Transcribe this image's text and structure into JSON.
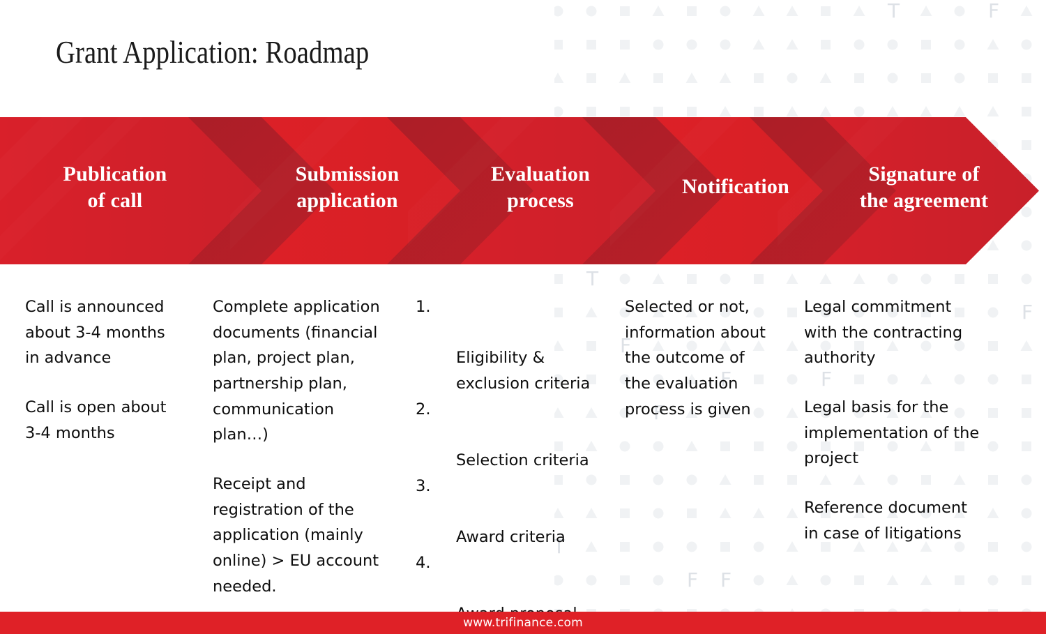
{
  "title": "Grant Application: Roadmap",
  "brand": {
    "red": "#DF2127",
    "red_dark": "#AE1F26",
    "red_mid": "#C5202A",
    "pattern_gray": "#F0F2F4",
    "text_dark": "#0d0d0d"
  },
  "roadmap": {
    "steps": [
      {
        "label": "Publication\nof call"
      },
      {
        "label": "Submission\napplication"
      },
      {
        "label": "Evaluation\nprocess"
      },
      {
        "label": "Notification"
      },
      {
        "label": "Signature of\nthe agreement"
      }
    ]
  },
  "columns": [
    {
      "key": "publication",
      "type": "paragraphs",
      "paragraphs": [
        "Call is announced\nabout 3-4 months\nin advance",
        "Call is open about\n3-4 months"
      ]
    },
    {
      "key": "submission",
      "type": "paragraphs",
      "paragraphs": [
        "Complete application\ndocuments (financial\nplan, project plan,\npartnership plan,\ncommunication\nplan…)",
        "Receipt and\nregistration of the\napplication (mainly\nonline) > EU account\nneeded."
      ]
    },
    {
      "key": "evaluation",
      "type": "numbered",
      "items": [
        {
          "num": "1.",
          "text": "Eligibility &\nexclusion criteria"
        },
        {
          "num": "2.",
          "text": "Selection criteria"
        },
        {
          "num": "3.",
          "text": "Award criteria"
        },
        {
          "num": "4.",
          "text": "Award proposal"
        }
      ]
    },
    {
      "key": "notification",
      "type": "paragraphs",
      "paragraphs": [
        "Selected or not,\ninformation about\nthe outcome of\nthe evaluation\nprocess is given"
      ]
    },
    {
      "key": "signature",
      "type": "paragraphs",
      "paragraphs": [
        "Legal commitment\nwith the contracting\nauthority",
        "Legal basis for the\nimplementation of the\nproject",
        "Reference document\nin case of litigations"
      ]
    }
  ],
  "footer": {
    "url": "www.trifinance.com"
  },
  "background_pattern": {
    "icon_names": [
      "circle-icon",
      "triangle-icon",
      "square-icon",
      "letter-t-icon",
      "letter-f-icon"
    ],
    "color": "#F0F2F4",
    "letter_color": "#DDE1E6"
  }
}
